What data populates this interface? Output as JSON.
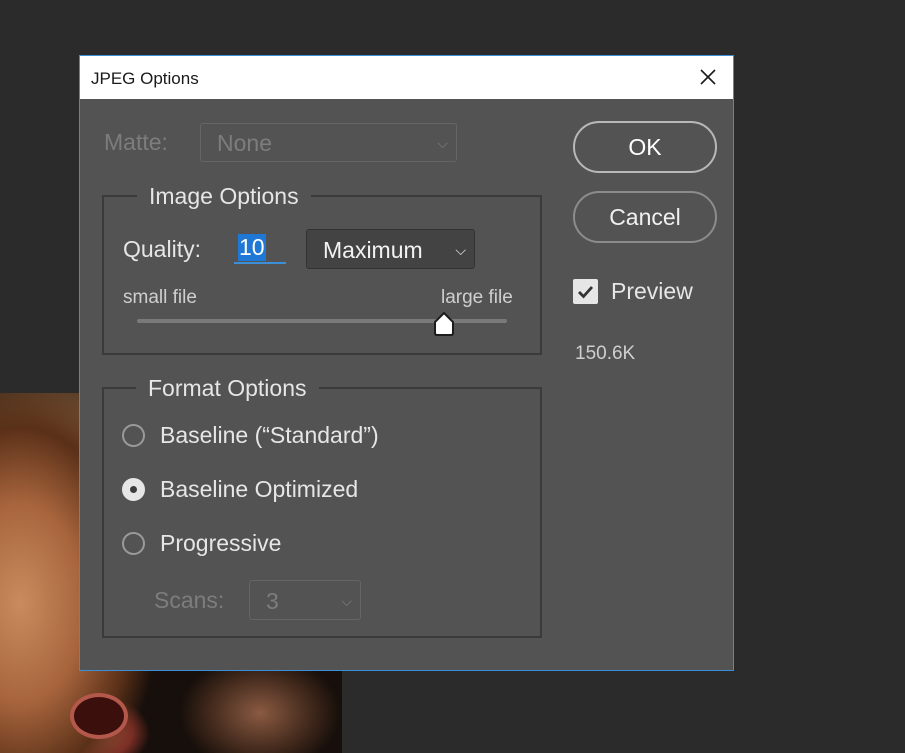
{
  "dialog": {
    "title": "JPEG Options",
    "matte": {
      "label": "Matte:",
      "value": "None"
    },
    "image_options": {
      "legend": "Image Options",
      "quality_label": "Quality:",
      "quality_value": "10",
      "quality_preset": "Maximum",
      "slider_min_label": "small file",
      "slider_max_label": "large file",
      "slider_fraction": 0.83
    },
    "format_options": {
      "legend": "Format Options",
      "options": [
        {
          "label": "Baseline (“Standard”)",
          "selected": false
        },
        {
          "label": "Baseline Optimized",
          "selected": true
        },
        {
          "label": "Progressive",
          "selected": false
        }
      ],
      "scans_label": "Scans:",
      "scans_value": "3"
    },
    "ok_label": "OK",
    "cancel_label": "Cancel",
    "preview_label": "Preview",
    "preview_checked": true,
    "file_size": "150.6K"
  },
  "icons": {
    "close": "close-icon",
    "chevron": "chevron-down-icon",
    "check": "checkmark-icon",
    "slider_thumb": "slider-thumb"
  },
  "colors": {
    "dialog_bg": "#535353",
    "accent": "#1f78d6",
    "window_border": "#3b8fd9"
  }
}
